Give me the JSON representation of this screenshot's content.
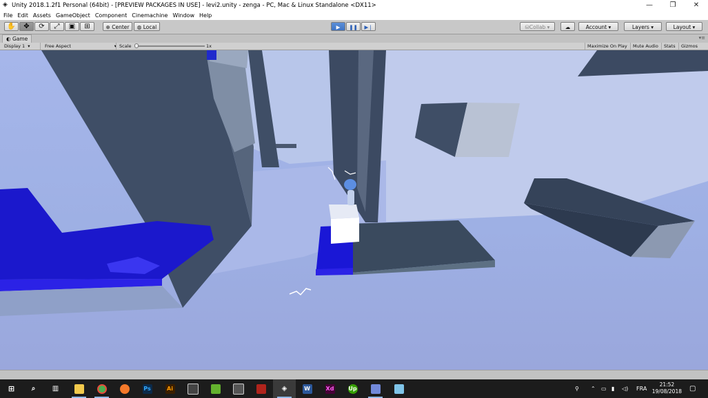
{
  "window": {
    "title": "Unity 2018.1.2f1 Personal (64bit) - [PREVIEW PACKAGES IN USE] - levi2.unity - zenga - PC, Mac & Linux Standalone <DX11>",
    "icons": {
      "app": "unity-logo-icon",
      "minimize": "minimize-icon",
      "maximize": "restore-icon",
      "close": "close-icon"
    }
  },
  "menu": [
    "File",
    "Edit",
    "Assets",
    "GameObject",
    "Component",
    "Cinemachine",
    "Window",
    "Help"
  ],
  "toolbar": {
    "tools": [
      "hand-tool-icon",
      "move-tool-icon",
      "rotate-tool-icon",
      "scale-tool-icon",
      "rect-tool-icon",
      "transform-tool-icon"
    ],
    "pivot_label": "Center",
    "space_label": "Local",
    "play": {
      "play": "play-icon",
      "pause": "pause-icon",
      "step": "step-icon",
      "playing": true
    },
    "collab_label": "Collab",
    "cloud": "cloud-icon",
    "account_label": "Account",
    "layers_label": "Layers",
    "layout_label": "Layout"
  },
  "game_tab": {
    "label": "Game",
    "icon": "game-view-icon",
    "display": "Display 1",
    "aspect": "Free Aspect",
    "scale_label": "Scale",
    "scale_value": "1x",
    "maximize_on_play": "Maximize On Play",
    "mute_audio": "Mute Audio",
    "stats": "Stats",
    "gizmos": "Gizmos"
  },
  "taskbar": {
    "apps": [
      {
        "name": "windows-start-icon",
        "glyph": "",
        "color": "#ffffff"
      },
      {
        "name": "search-icon",
        "glyph": "",
        "color": "#ffffff"
      },
      {
        "name": "task-view-icon",
        "glyph": "",
        "color": "#ffffff"
      },
      {
        "name": "file-explorer-icon",
        "glyph": "",
        "color": "#f2c94c"
      },
      {
        "name": "chrome-icon",
        "glyph": "",
        "color": "#4caf50"
      },
      {
        "name": "blender-icon",
        "glyph": "",
        "color": "#f5792a"
      },
      {
        "name": "photoshop-icon",
        "glyph": "Ps",
        "color": "#0b2a4a"
      },
      {
        "name": "illustrator-icon",
        "glyph": "Ai",
        "color": "#3a1e00"
      },
      {
        "name": "video-editor-icon",
        "glyph": "",
        "color": "#444444"
      },
      {
        "name": "camtasia-icon",
        "glyph": "",
        "color": "#64b22e"
      },
      {
        "name": "capture-icon",
        "glyph": "",
        "color": "#555555"
      },
      {
        "name": "winrar-icon",
        "glyph": "",
        "color": "#b0241c"
      },
      {
        "name": "unity-icon",
        "glyph": "",
        "color": "#222222"
      },
      {
        "name": "word-icon",
        "glyph": "W",
        "color": "#2b579a"
      },
      {
        "name": "xd-icon",
        "glyph": "Xd",
        "color": "#470137"
      },
      {
        "name": "upwork-icon",
        "glyph": "Up",
        "color": "#37a000"
      },
      {
        "name": "discord-icon",
        "glyph": "",
        "color": "#7289da"
      },
      {
        "name": "notepad-icon",
        "glyph": "",
        "color": "#7fc4e8"
      }
    ],
    "tray_icons": [
      "people-icon",
      "chevron-up-icon",
      "network-icon",
      "battery-icon",
      "volume-icon"
    ],
    "language": "FRA",
    "time": "21:52",
    "date": "19/08/2018",
    "notifications": "notification-icon"
  }
}
